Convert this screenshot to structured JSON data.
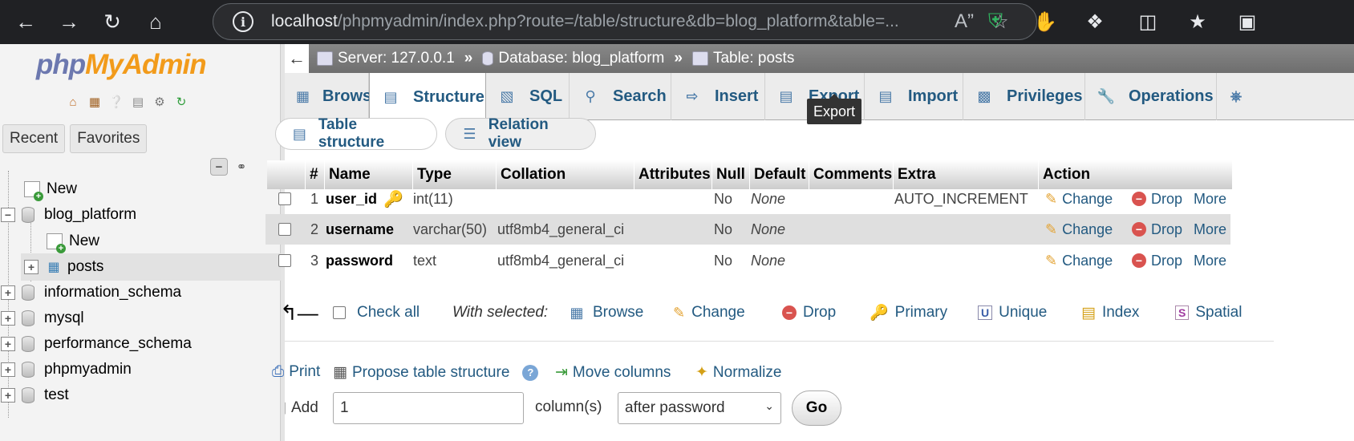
{
  "browser": {
    "url_host": "localhost",
    "url_path": "/phpmyadmin/index.php?route=/table/structure&db=blog_platform&table=..."
  },
  "sidebar": {
    "logo_php": "php",
    "logo_myadmin": "MyAdmin",
    "tabs": [
      "Recent",
      "Favorites"
    ],
    "tree": [
      {
        "label": "New",
        "type": "new"
      },
      {
        "label": "blog_platform",
        "type": "db"
      },
      {
        "label": "New",
        "type": "new"
      },
      {
        "label": "posts",
        "type": "table"
      },
      {
        "label": "information_schema",
        "type": "db"
      },
      {
        "label": "mysql",
        "type": "db"
      },
      {
        "label": "performance_schema",
        "type": "db"
      },
      {
        "label": "phpmyadmin",
        "type": "db"
      },
      {
        "label": "test",
        "type": "db"
      }
    ]
  },
  "breadcrumb": {
    "server": "Server: 127.0.0.1",
    "database": "Database: blog_platform",
    "table": "Table: posts",
    "sep": "»"
  },
  "tabs": [
    "Browse",
    "Structure",
    "SQL",
    "Search",
    "Insert",
    "Export",
    "Import",
    "Privileges",
    "Operations"
  ],
  "tooltip": "Export",
  "subtabs": [
    "Table structure",
    "Relation view"
  ],
  "table": {
    "headers": [
      "#",
      "Name",
      "Type",
      "Collation",
      "Attributes",
      "Null",
      "Default",
      "Comments",
      "Extra",
      "Action"
    ],
    "rows": [
      {
        "num": "1",
        "name": "user_id",
        "type": "int(11)",
        "collation": "",
        "attributes": "",
        "null": "No",
        "default": "None",
        "comments": "",
        "extra": "AUTO_INCREMENT"
      },
      {
        "num": "2",
        "name": "username",
        "type": "varchar(50)",
        "collation": "utf8mb4_general_ci",
        "attributes": "",
        "null": "No",
        "default": "None",
        "comments": "",
        "extra": ""
      },
      {
        "num": "3",
        "name": "password",
        "type": "text",
        "collation": "utf8mb4_general_ci",
        "attributes": "",
        "null": "No",
        "default": "None",
        "comments": "",
        "extra": ""
      }
    ],
    "actions": {
      "change": "Change",
      "drop": "Drop",
      "more": "More"
    }
  },
  "bulk": {
    "check_all": "Check all",
    "with_selected": "With selected:",
    "browse": "Browse",
    "change": "Change",
    "drop": "Drop",
    "primary": "Primary",
    "unique": "Unique",
    "index": "Index",
    "spatial": "Spatial"
  },
  "bottom_links": {
    "print": "Print",
    "propose": "Propose table structure",
    "move": "Move columns",
    "normalize": "Normalize"
  },
  "add_columns": {
    "label": "Add",
    "count": "1",
    "unit": "column(s)",
    "position": "after password",
    "go": "Go"
  }
}
